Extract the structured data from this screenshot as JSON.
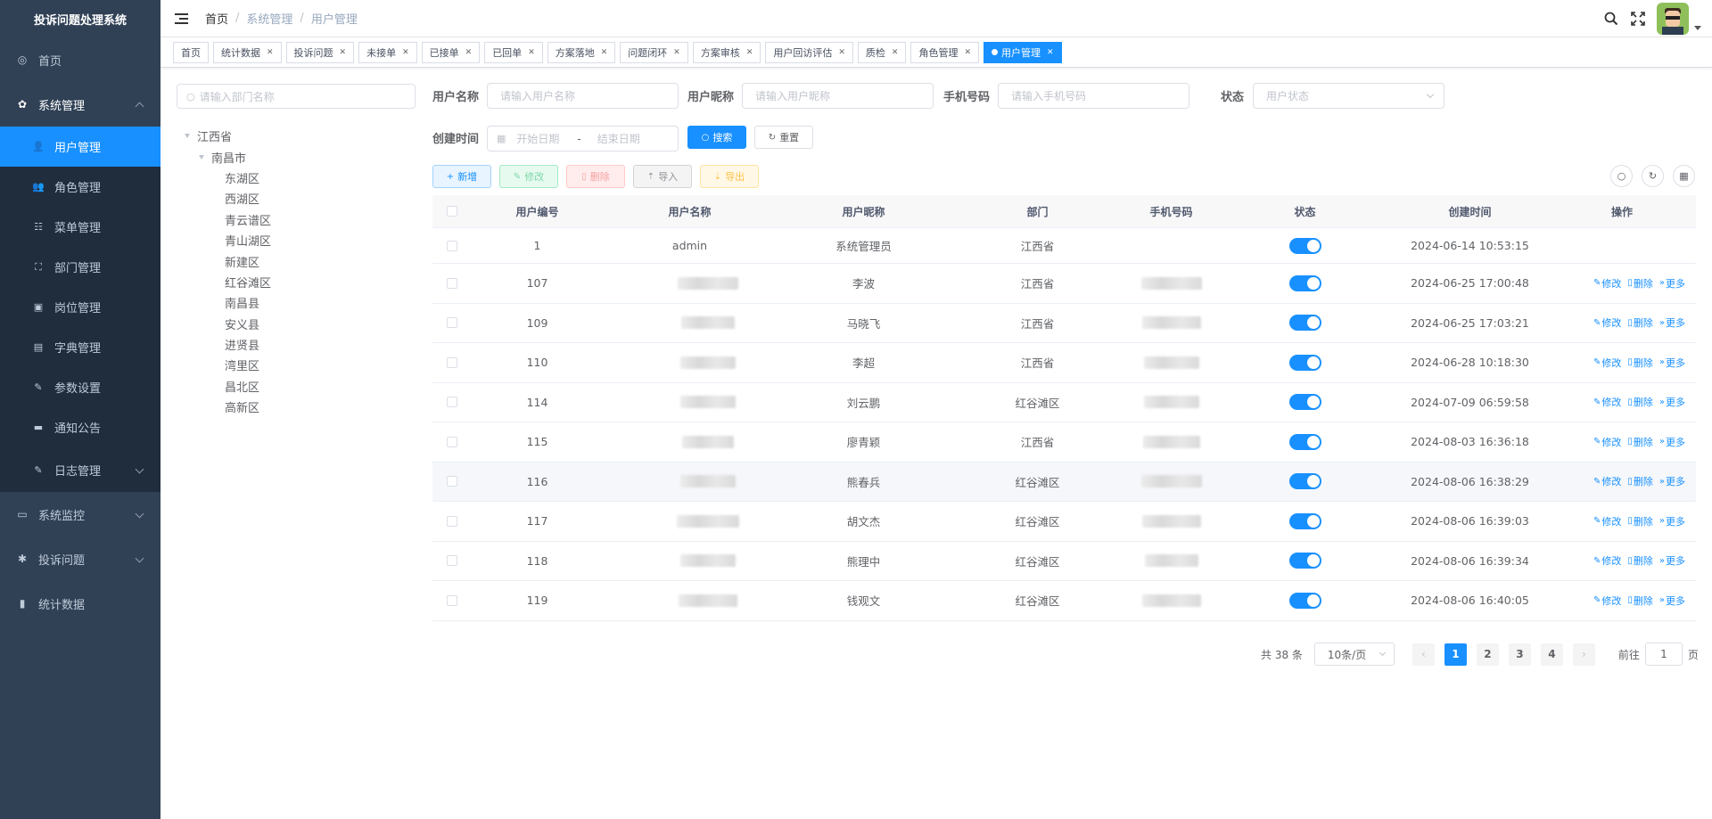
{
  "app": {
    "title": "投诉问题处理系统"
  },
  "sidebar": {
    "home": "首页",
    "system": "系统管理",
    "items": [
      {
        "label": "用户管理",
        "icon": "user-icon",
        "glyph": "👤"
      },
      {
        "label": "角色管理",
        "icon": "peoples-icon",
        "glyph": "👥"
      },
      {
        "label": "菜单管理",
        "icon": "tree-table-icon",
        "glyph": "☷"
      },
      {
        "label": "部门管理",
        "icon": "tree-icon",
        "glyph": "⛶"
      },
      {
        "label": "岗位管理",
        "icon": "post-icon",
        "glyph": "▣"
      },
      {
        "label": "字典管理",
        "icon": "dict-icon",
        "glyph": "▤"
      },
      {
        "label": "参数设置",
        "icon": "edit-icon",
        "glyph": "✎"
      },
      {
        "label": "通知公告",
        "icon": "message-icon",
        "glyph": "▬"
      },
      {
        "label": "日志管理",
        "icon": "log-icon",
        "glyph": "✎"
      }
    ],
    "monitor": "系统监控",
    "complaint": "投诉问题",
    "stats": "统计数据"
  },
  "navbar": {
    "breadcrumb": [
      "首页",
      "系统管理",
      "用户管理"
    ]
  },
  "tags": [
    {
      "label": "首页",
      "closable": false,
      "active": false
    },
    {
      "label": "统计数据",
      "closable": true,
      "active": false
    },
    {
      "label": "投诉问题",
      "closable": true,
      "active": false
    },
    {
      "label": "未接单",
      "closable": true,
      "active": false
    },
    {
      "label": "已接单",
      "closable": true,
      "active": false
    },
    {
      "label": "已回单",
      "closable": true,
      "active": false
    },
    {
      "label": "方案落地",
      "closable": true,
      "active": false
    },
    {
      "label": "问题闭环",
      "closable": true,
      "active": false
    },
    {
      "label": "方案审核",
      "closable": true,
      "active": false
    },
    {
      "label": "用户回访评估",
      "closable": true,
      "active": false
    },
    {
      "label": "质检",
      "closable": true,
      "active": false
    },
    {
      "label": "角色管理",
      "closable": true,
      "active": false
    },
    {
      "label": "用户管理",
      "closable": true,
      "active": true
    }
  ],
  "dept": {
    "placeholder": "请输入部门名称",
    "root": "江西省",
    "city": "南昌市",
    "districts": [
      "东湖区",
      "西湖区",
      "青云谱区",
      "青山湖区",
      "新建区",
      "红谷滩区",
      "南昌县",
      "安义县",
      "进贤县",
      "湾里区",
      "昌北区",
      "高新区"
    ]
  },
  "filters": {
    "username_label": "用户名称",
    "username_placeholder": "请输入用户名称",
    "nickname_label": "用户昵称",
    "nickname_placeholder": "请输入用户昵称",
    "phone_label": "手机号码",
    "phone_placeholder": "请输入手机号码",
    "status_label": "状态",
    "status_placeholder": "用户状态",
    "created_label": "创建时间",
    "start_placeholder": "开始日期",
    "range_sep": "-",
    "end_placeholder": "结束日期",
    "search": "搜索",
    "reset": "重置"
  },
  "toolbar": {
    "add": "新增",
    "edit": "修改",
    "delete": "删除",
    "import": "导入",
    "export": "导出"
  },
  "table": {
    "headers": [
      "用户编号",
      "用户名称",
      "用户昵称",
      "部门",
      "手机号码",
      "状态",
      "创建时间",
      "操作"
    ],
    "ops": [
      "修改",
      "删除",
      "更多"
    ],
    "rows": [
      {
        "id": "1",
        "name": "admin",
        "nick": "系统管理员",
        "dept": "江西省",
        "phone": "",
        "status": true,
        "created": "2024-06-14 10:53:15",
        "ops": false
      },
      {
        "id": "107",
        "name": "",
        "nick": "李波",
        "dept": "江西省",
        "phone": "",
        "status": true,
        "created": "2024-06-25 17:00:48",
        "ops": true
      },
      {
        "id": "109",
        "name": "",
        "nick": "马晓飞",
        "dept": "江西省",
        "phone": "",
        "status": true,
        "created": "2024-06-25 17:03:21",
        "ops": true
      },
      {
        "id": "110",
        "name": "",
        "nick": "李超",
        "dept": "江西省",
        "phone": "",
        "status": true,
        "created": "2024-06-28 10:18:30",
        "ops": true
      },
      {
        "id": "114",
        "name": "",
        "nick": "刘云鹏",
        "dept": "红谷滩区",
        "phone": "",
        "status": true,
        "created": "2024-07-09 06:59:58",
        "ops": true
      },
      {
        "id": "115",
        "name": "",
        "nick": "廖青颖",
        "dept": "江西省",
        "phone": "",
        "status": true,
        "created": "2024-08-03 16:36:18",
        "ops": true
      },
      {
        "id": "116",
        "name": "",
        "nick": "熊春兵",
        "dept": "红谷滩区",
        "phone": "",
        "status": true,
        "created": "2024-08-06 16:38:29",
        "ops": true
      },
      {
        "id": "117",
        "name": "",
        "nick": "胡文杰",
        "dept": "红谷滩区",
        "phone": "",
        "status": true,
        "created": "2024-08-06 16:39:03",
        "ops": true
      },
      {
        "id": "118",
        "name": "",
        "nick": "熊理中",
        "dept": "红谷滩区",
        "phone": "",
        "status": true,
        "created": "2024-08-06 16:39:34",
        "ops": true
      },
      {
        "id": "119",
        "name": "",
        "nick": "钱观文",
        "dept": "红谷滩区",
        "phone": "",
        "status": true,
        "created": "2024-08-06 16:40:05",
        "ops": true
      }
    ]
  },
  "pagination": {
    "total": "共 38 条",
    "page_size": "10条/页",
    "pages": [
      "1",
      "2",
      "3",
      "4"
    ],
    "current": "1",
    "goto_label": "前往",
    "goto_value": "1",
    "page_unit": "页"
  },
  "colors": {
    "primary": "#1890ff",
    "sidebar": "#304156",
    "submenu": "#1f2d3d"
  }
}
